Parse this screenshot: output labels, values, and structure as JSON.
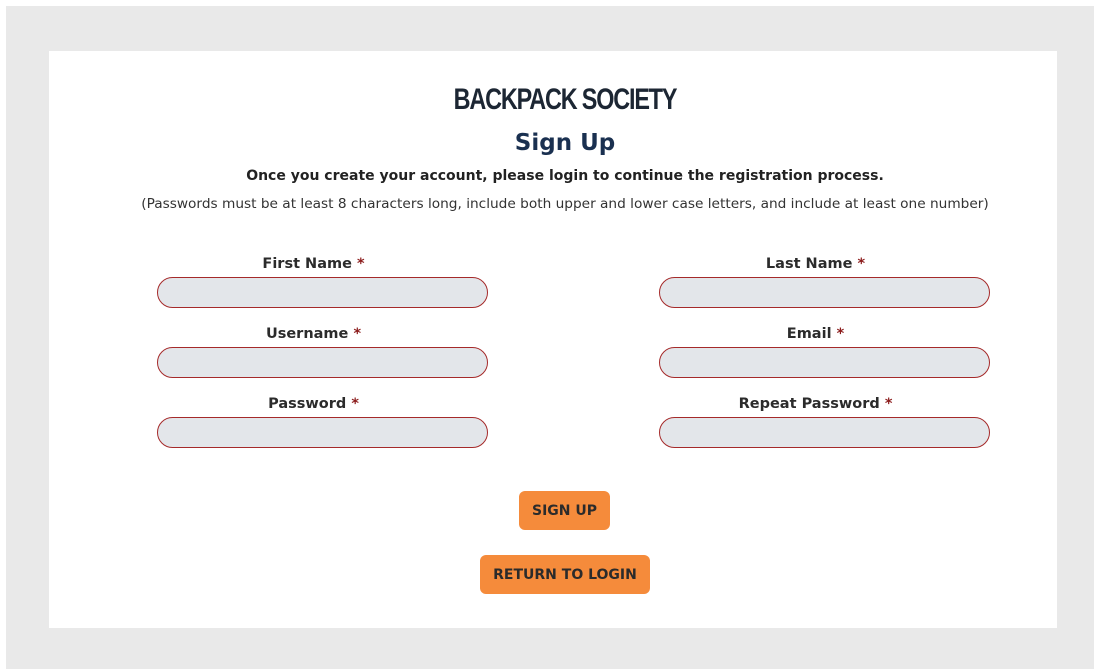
{
  "header": {
    "brand": "BACKPACK SOCIETY",
    "title": "Sign Up",
    "subtitle": "Once you create your account, please login to continue the registration process.",
    "note": "(Passwords must be at least 8 characters long, include both upper and lower case letters, and include at least one number)"
  },
  "form": {
    "required_marker": "*",
    "fields": {
      "first_name": {
        "label": "First Name",
        "value": ""
      },
      "last_name": {
        "label": "Last Name",
        "value": ""
      },
      "username": {
        "label": "Username",
        "value": ""
      },
      "email": {
        "label": "Email",
        "value": ""
      },
      "password": {
        "label": "Password",
        "value": ""
      },
      "repeat_password": {
        "label": "Repeat Password",
        "value": ""
      }
    }
  },
  "actions": {
    "sign_up": "SIGN UP",
    "return_to_login": "RETURN TO LOGIN"
  },
  "colors": {
    "page_background": "#e9e9e9",
    "card_background": "#ffffff",
    "button": "#f58b3b",
    "input_border": "#a52a2a",
    "input_fill": "#e3e6ea",
    "required_marker": "#8b1a1a",
    "title": "#1a3050"
  }
}
